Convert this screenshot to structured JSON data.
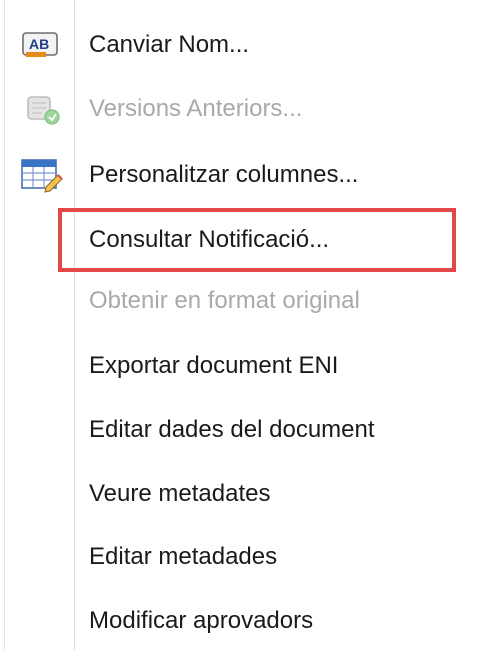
{
  "context_menu": {
    "items": [
      {
        "label": "Canviar Nom...",
        "icon": "rename-icon",
        "enabled": true
      },
      {
        "label": "Versions Anteriors...",
        "icon": "previous-versions-icon",
        "enabled": false
      },
      {
        "label": "Personalitzar columnes...",
        "icon": "customize-columns-icon",
        "enabled": true
      },
      {
        "label": "Consultar Notificació...",
        "icon": "",
        "enabled": true,
        "highlighted": true
      },
      {
        "label": "Obtenir en format original",
        "icon": "",
        "enabled": false
      },
      {
        "label": "Exportar document ENI",
        "icon": "",
        "enabled": true
      },
      {
        "label": "Editar dades del document",
        "icon": "",
        "enabled": true
      },
      {
        "label": "Veure metadates",
        "icon": "",
        "enabled": true
      },
      {
        "label": "Editar metadades",
        "icon": "",
        "enabled": true
      },
      {
        "label": "Modificar aprovadors",
        "icon": "",
        "enabled": true
      }
    ],
    "rename_icon_text": "AB",
    "highlight_color": "#e0484a"
  }
}
